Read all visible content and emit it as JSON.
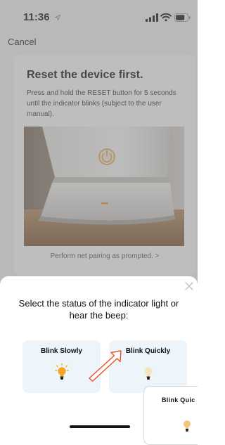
{
  "status_bar": {
    "time": "11:36"
  },
  "nav": {
    "cancel_label": "Cancel"
  },
  "instruction_card": {
    "title": "Reset the device first.",
    "description": "Press and hold the RESET button for 5 seconds until the indicator blinks (subject to the user manual).",
    "link_label": "Perform net pairing as prompted. >"
  },
  "sheet": {
    "title": "Select the status of the indicator light or hear the beep:",
    "options": [
      {
        "label": "Blink Slowly",
        "icon": "lightbulb-on-icon"
      },
      {
        "label": "Blink Quickly",
        "icon": "lightbulb-off-icon"
      }
    ]
  },
  "zoom_inset": {
    "label": "Blink Quic"
  },
  "colors": {
    "overlay": "#808080",
    "option_bg": "#eef5fa",
    "bulb_lit": "#f5a623",
    "bulb_unlit": "#f7e3c0",
    "arrow": "#e8542a"
  }
}
